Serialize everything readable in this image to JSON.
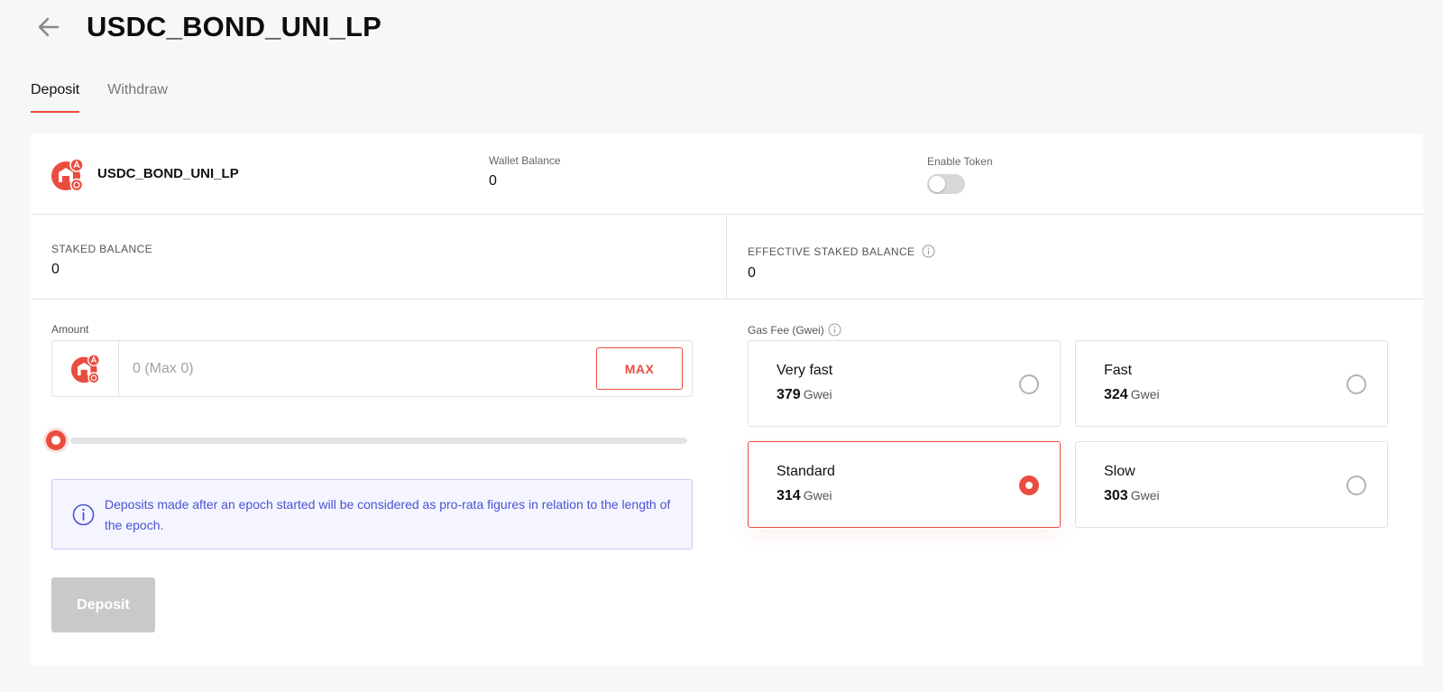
{
  "header": {
    "title": "USDC_BOND_UNI_LP",
    "back_icon": "arrow-left-icon"
  },
  "tabs": [
    {
      "label": "Deposit",
      "active": true
    },
    {
      "label": "Withdraw",
      "active": false
    }
  ],
  "token": {
    "name": "USDC_BOND_UNI_LP",
    "icon": "token-logo-icon"
  },
  "wallet": {
    "label": "Wallet Balance",
    "value": "0"
  },
  "enable_token": {
    "label": "Enable Token",
    "enabled": false
  },
  "staked": {
    "label": "STAKED BALANCE",
    "value": "0"
  },
  "effective_staked": {
    "label": "EFFECTIVE STAKED BALANCE",
    "value": "0"
  },
  "amount": {
    "label": "Amount",
    "placeholder": "0 (Max 0)",
    "value": "",
    "max_label": "MAX",
    "slider_fraction": 0
  },
  "notice": {
    "text": "Deposits made after an epoch started will be considered as pro-rata figures in relation to the length of the epoch."
  },
  "deposit_button": {
    "label": "Deposit",
    "enabled": false
  },
  "gas": {
    "label": "Gas Fee (Gwei)",
    "unit": "Gwei",
    "options": [
      {
        "name": "Very fast",
        "value": "379",
        "selected": false
      },
      {
        "name": "Fast",
        "value": "324",
        "selected": false
      },
      {
        "name": "Standard",
        "value": "314",
        "selected": true
      },
      {
        "name": "Slow",
        "value": "303",
        "selected": false
      }
    ]
  },
  "colors": {
    "accent": "#ea4c3f",
    "notice_text": "#4a52d4",
    "notice_bg": "#f4f5fe",
    "disabled": "#c9c9cc",
    "background": "#f7f7f8"
  }
}
